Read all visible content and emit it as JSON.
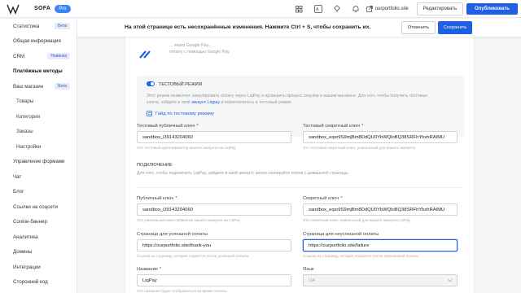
{
  "topbar": {
    "brand": "SOFA",
    "plan": "Pro",
    "site": "ourportfolio.site",
    "edit_label": "Редактировать",
    "publish_label": "Опубликовать",
    "icons": [
      "grid-icon",
      "language-icon",
      "lightbulb-icon",
      "bell-icon",
      "external-link-icon"
    ]
  },
  "sidebar": {
    "items": [
      {
        "label": "Статистика",
        "badge": "Бета"
      },
      {
        "label": "Общая информация",
        "badge": ""
      },
      {
        "label": "CRM",
        "badge": "Новинка"
      },
      {
        "label": "Платёжные методы",
        "badge": "",
        "active": true
      },
      {
        "label": "Ваш магазин",
        "badge": "Бета"
      },
      {
        "label": "Товары",
        "badge": ""
      },
      {
        "label": "Категории",
        "badge": ""
      },
      {
        "label": "Заказы",
        "badge": ""
      },
      {
        "label": "Настройки",
        "badge": ""
      },
      {
        "label": "Управление формами",
        "badge": ""
      },
      {
        "label": "Чат",
        "badge": ""
      },
      {
        "label": "Блог",
        "badge": ""
      },
      {
        "label": "Ссылки на соцсети",
        "badge": ""
      },
      {
        "label": "Cookie-баннер",
        "badge": ""
      },
      {
        "label": "Аналитика",
        "badge": ""
      },
      {
        "label": "Домены",
        "badge": ""
      },
      {
        "label": "Интеграции",
        "badge": ""
      },
      {
        "label": "Сторонний код",
        "badge": ""
      }
    ]
  },
  "banner": {
    "text": "На этой странице есть несохранённые изменения. Нажмите Ctrl + S, чтобы сохранить их.",
    "cancel_label": "Отменить",
    "save_label": "Сохранить"
  },
  "googlepay": {
    "line1": "... через Google Pay...",
    "line2": "оплату с помощью Google Pay."
  },
  "test_mode": {
    "title": "Тестовый режим",
    "enabled": true,
    "desc_line1": "Этот режим позволяет симулировать оплату через LiqPay и проверить процесс покупки в вашем магазине. Для того, чтобы получить тестовые",
    "desc_line2_prefix": "ключи, зайдите в свой ",
    "desc_link": "аккаунт Liqpay",
    "desc_line2_suffix": " и переключитесь в тестовый режим.",
    "guide_label": "Гайд по тестовому режиму",
    "public_key_label": "Тестовый публичный ключ",
    "public_key_value": "sandbox_i39143204060",
    "public_key_hint": "Это тестовый идентификатор вашего аккаунта на LiqPay",
    "secret_key_label": "Тестовый секретный ключ",
    "secret_key_value": "sandbox_eqsr9S9mjBm8DdQU0YbWQloBQ38SRFhYbxhRAIMU",
    "secret_key_hint": "Это тестовый секретный ключ, уникальный для вашего аккаунта"
  },
  "connection": {
    "title": "Подключение",
    "desc": "Для того, чтобы подключить LiqPay, зайдите в свой аккаунт, затем скопируйте ключи с домашней страницы.",
    "public_key_label": "Публичный ключ",
    "public_key_value": "sandbox_i39143204060",
    "public_key_hint": "Это уникальный идентификатор вашего аккаунта на LiqPay",
    "secret_key_label": "Секретный ключ",
    "secret_key_value": "sandbox_eqsr9S9mjBm8DdQU0YbWQloBQ38SRFhYbxhRAIMU",
    "secret_key_hint": "Это секретный ключ, уникальный для вашего аккаунта LiqPay",
    "success_label": "Страница для успешной оплаты",
    "success_value": "https://ourportfolio.site/thank-you",
    "success_hint": "Ссылка на страницу, которая откроется после успешной оплаты",
    "failure_label": "Страница для неуспешной оплаты",
    "failure_value": "https://ourportfolio.site/failure",
    "failure_hint": "Ссылка на страницу, которая откроется после неуспешной оплаты",
    "name_label": "Название",
    "name_value": "LiqPay",
    "name_hint": "Это название будет отображаться во время оплаты",
    "language_label": "Язык",
    "language_value": "UA"
  },
  "colors": {
    "accent": "#1f5fe0",
    "badge_bg": "#e4ebfa",
    "required": "#ee1111"
  }
}
